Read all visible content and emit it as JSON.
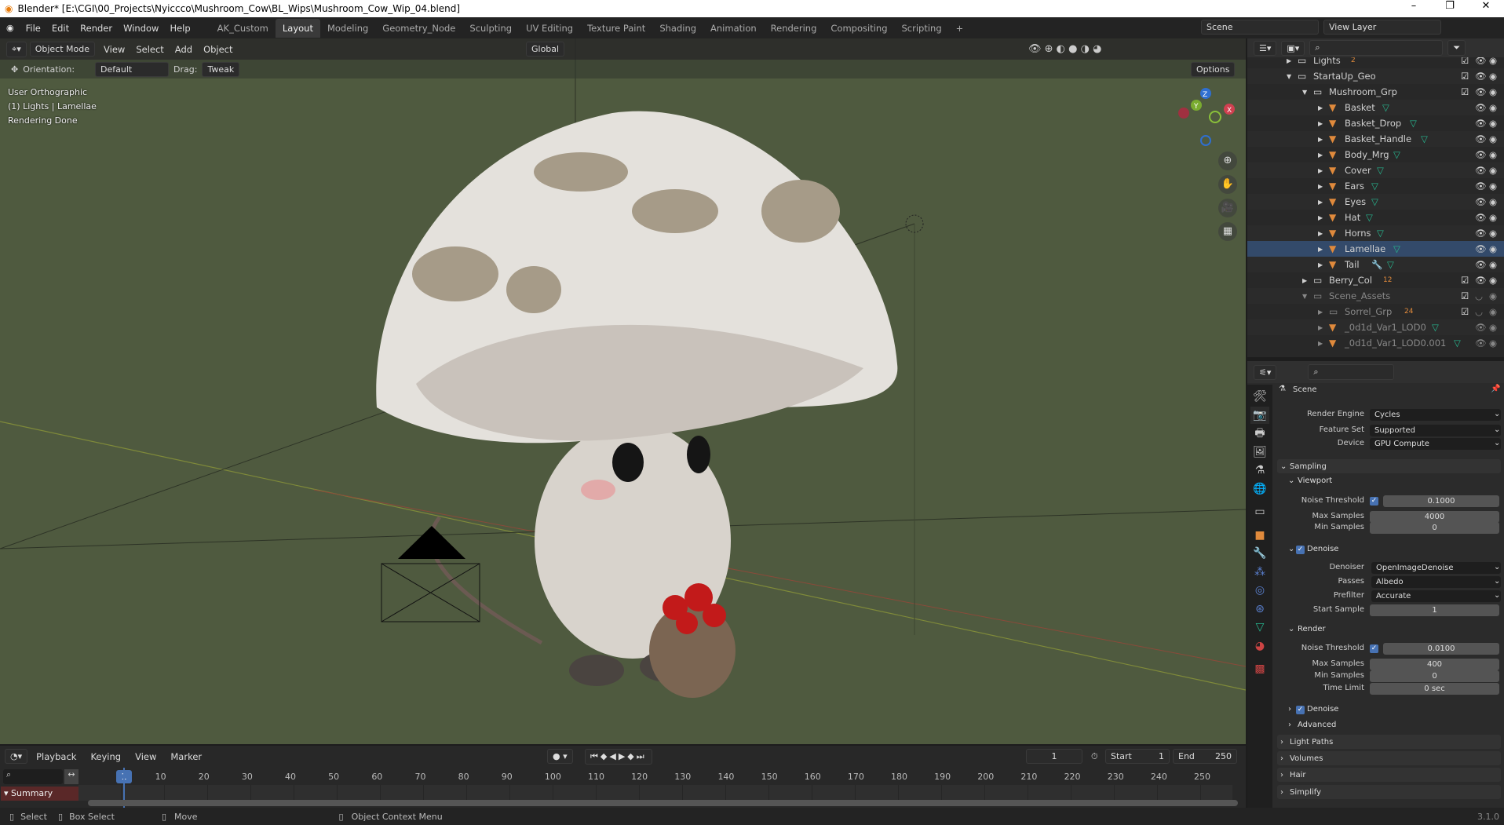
{
  "window": {
    "title": "Blender* [E:\\CGI\\00_Projects\\Nyiccco\\Mushroom_Cow\\BL_Wips\\Mushroom_Cow_Wip_04.blend]",
    "minimize": "–",
    "maximize": "❐",
    "close": "✕"
  },
  "topbar": {
    "menus": [
      "File",
      "Edit",
      "Render",
      "Window",
      "Help"
    ],
    "workspaces": [
      "AK_Custom",
      "Layout",
      "Modeling",
      "Geometry_Node",
      "Sculpting",
      "UV Editing",
      "Texture Paint",
      "Shading",
      "Animation",
      "Rendering",
      "Compositing",
      "Scripting"
    ],
    "active_workspace": "Layout",
    "add": "+",
    "scene": "Scene",
    "view_layer": "View Layer"
  },
  "viewport": {
    "mode": "Object Mode",
    "menus": [
      "View",
      "Select",
      "Add",
      "Object"
    ],
    "transform": "Global",
    "orientation_label": "Orientation:",
    "orientation": "Default",
    "drag_label": "Drag:",
    "drag": "Tweak",
    "options": "Options",
    "overlay": [
      "User Orthographic",
      "(1) Lights | Lamellae",
      "Rendering Done"
    ],
    "gizmo": {
      "x": "X",
      "y": "Y",
      "z": "Z"
    }
  },
  "outliner": {
    "items": [
      {
        "name": "Lights",
        "level": 0,
        "type": "collection",
        "expanded": false,
        "badge": "2",
        "check": true
      },
      {
        "name": "StartaUp_Geo",
        "level": 0,
        "type": "collection",
        "expanded": true,
        "check": true
      },
      {
        "name": "Mushroom_Grp",
        "level": 1,
        "type": "collection",
        "expanded": true,
        "check": true
      },
      {
        "name": "Basket",
        "level": 2,
        "type": "mesh"
      },
      {
        "name": "Basket_Drop",
        "level": 2,
        "type": "mesh"
      },
      {
        "name": "Basket_Handle",
        "level": 2,
        "type": "mesh"
      },
      {
        "name": "Body_Mrg",
        "level": 2,
        "type": "mesh"
      },
      {
        "name": "Cover",
        "level": 2,
        "type": "mesh"
      },
      {
        "name": "Ears",
        "level": 2,
        "type": "mesh"
      },
      {
        "name": "Eyes",
        "level": 2,
        "type": "mesh"
      },
      {
        "name": "Hat",
        "level": 2,
        "type": "mesh"
      },
      {
        "name": "Horns",
        "level": 2,
        "type": "mesh"
      },
      {
        "name": "Lamellae",
        "level": 2,
        "type": "mesh",
        "active": true
      },
      {
        "name": "Tail",
        "level": 2,
        "type": "mesh",
        "modifiers": true
      },
      {
        "name": "Berry_Col",
        "level": 1,
        "type": "collection",
        "expanded": false,
        "badge": "12",
        "check": true
      },
      {
        "name": "Scene_Assets",
        "level": 1,
        "type": "collection",
        "expanded": true,
        "check": true,
        "dim": true,
        "hidden": true
      },
      {
        "name": "Sorrel_Grp",
        "level": 2,
        "type": "collection",
        "badge": "24",
        "check": true,
        "dim": true,
        "hidden": true
      },
      {
        "name": "_0d1d_Var1_LOD0",
        "level": 2,
        "type": "mesh",
        "dim": true
      },
      {
        "name": "_0d1d_Var1_LOD0.001",
        "level": 2,
        "type": "mesh",
        "dim": true
      }
    ]
  },
  "properties": {
    "context": "Scene",
    "render_engine_label": "Render Engine",
    "render_engine": "Cycles",
    "feature_set_label": "Feature Set",
    "feature_set": "Supported",
    "device_label": "Device",
    "device": "GPU Compute",
    "sampling": "Sampling",
    "viewport": "Viewport",
    "noise_label": "Noise Threshold",
    "vp_noise": "0.1000",
    "max_label": "Max Samples",
    "vp_max": "4000",
    "min_label": "Min Samples",
    "vp_min": "0",
    "denoise": "Denoise",
    "denoiser_label": "Denoiser",
    "denoiser": "OpenImageDenoise",
    "passes_label": "Passes",
    "passes": "Albedo",
    "prefilter_label": "Prefilter",
    "prefilter": "Accurate",
    "start_label": "Start Sample",
    "start": "1",
    "render": "Render",
    "r_noise": "0.0100",
    "r_max": "400",
    "r_min": "0",
    "time_label": "Time Limit",
    "time": "0 sec",
    "advanced": "Advanced",
    "light_paths": "Light Paths",
    "volumes": "Volumes",
    "hair": "Hair",
    "simplify": "Simplify",
    "check": "✓"
  },
  "timeline": {
    "menus": [
      "Playback",
      "Keying",
      "View",
      "Marker"
    ],
    "current_frame": "1",
    "start_label": "Start",
    "start": "1",
    "end_label": "End",
    "end": "250",
    "ticks": [
      "10",
      "20",
      "30",
      "40",
      "50",
      "60",
      "70",
      "80",
      "90",
      "100",
      "110",
      "120",
      "130",
      "140",
      "150",
      "160",
      "170",
      "180",
      "190",
      "200",
      "210",
      "220",
      "230",
      "240",
      "250"
    ],
    "summary": "Summary"
  },
  "status": {
    "select": "Select",
    "box_select": "Box Select",
    "move": "Move",
    "context_menu": "Object Context Menu",
    "version": "3.1.0"
  },
  "colors": {
    "viewport_bg": "#4f5a3f",
    "accent": "#4772b3",
    "object_orange": "#e08a3c",
    "mesh_green": "#27b68f"
  }
}
